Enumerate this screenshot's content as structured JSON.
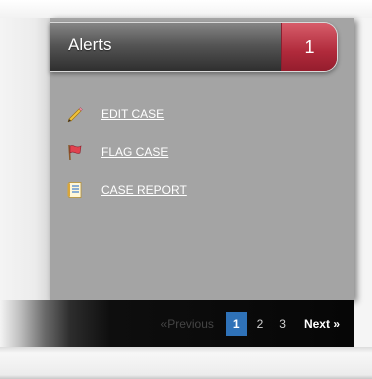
{
  "alerts": {
    "title": "Alerts",
    "count": "1"
  },
  "actions": [
    {
      "label": "EDIT CASE",
      "icon": "pencil-icon"
    },
    {
      "label": "FLAG CASE",
      "icon": "flag-icon"
    },
    {
      "label": "CASE REPORT",
      "icon": "report-icon"
    }
  ],
  "pagination": {
    "previous": "«Previous",
    "pages": [
      "1",
      "2",
      "3"
    ],
    "current": "1",
    "next": "Next »"
  },
  "colors": {
    "panel": "#a4a4a4",
    "badge": "#b02a3b",
    "active_page": "#2f72b8"
  }
}
